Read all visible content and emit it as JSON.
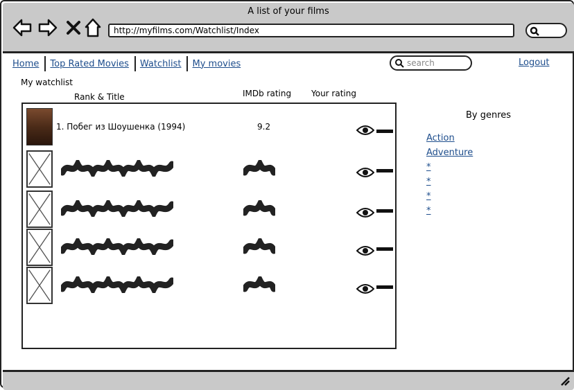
{
  "window": {
    "title": "A list of your films"
  },
  "browser": {
    "url": "http://myfilms.com/Watchlist/Index"
  },
  "nav": {
    "items": [
      "Home",
      "Top Rated Movies",
      "Watchlist",
      "My movies"
    ],
    "search_placeholder": "search",
    "logout": "Logout"
  },
  "section": {
    "title": "My watchlist"
  },
  "table": {
    "headers": {
      "rank_title": "Rank & Title",
      "imdb": "IMDb rating",
      "yours": "Your rating"
    },
    "rows": [
      {
        "title": "1. Побег из Шоушенка (1994)",
        "imdb": "9.2"
      }
    ],
    "placeholder_rows": 4
  },
  "genres": {
    "heading": "By genres",
    "items": [
      "Action",
      "Adventure",
      "*",
      "*",
      "*",
      "*"
    ]
  },
  "icons": {
    "back": "arrow-left-icon",
    "forward": "arrow-right-icon",
    "stop": "close-icon",
    "home": "home-icon",
    "search": "search-icon",
    "eye": "eye-icon",
    "resize": "resize-grip-icon"
  }
}
